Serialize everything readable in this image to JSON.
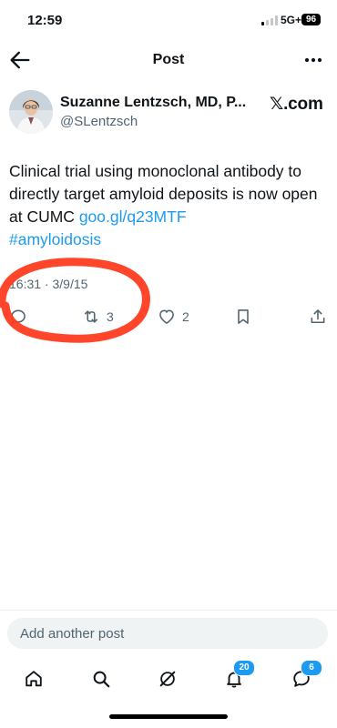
{
  "status_bar": {
    "time": "12:59",
    "network": "5G+",
    "battery": "96"
  },
  "header": {
    "title": "Post",
    "back_icon": "arrow-left-icon",
    "more_icon": "more-dots-icon"
  },
  "author": {
    "name": "Suzanne Lentzsch, MD, P...",
    "handle": "@SLentzsch",
    "source": "𝕏.com"
  },
  "post": {
    "text": "Clinical trial using monoclonal antibody to directly target amyloid deposits is now open at CUMC ",
    "link": "goo.gl/q23MTF",
    "hashtag": "#amyloidosis",
    "timestamp": "16:31 · 3/9/15"
  },
  "actions": {
    "reply_icon": "reply-icon",
    "retweet_icon": "retweet-icon",
    "retweet_count": "3",
    "like_icon": "heart-icon",
    "like_count": "2",
    "bookmark_icon": "bookmark-icon",
    "share_icon": "share-icon"
  },
  "reply": {
    "placeholder": "Add another post"
  },
  "tabs": [
    {
      "name": "home",
      "icon": "home-icon"
    },
    {
      "name": "search",
      "icon": "search-icon"
    },
    {
      "name": "grok",
      "icon": "grok-icon"
    },
    {
      "name": "notifications",
      "icon": "bell-icon",
      "badge": "20"
    },
    {
      "name": "messages",
      "icon": "messages-icon",
      "badge": "6"
    }
  ],
  "colors": {
    "accent": "#1d9bf0",
    "annotation": "#ff3b1f",
    "muted": "#536471"
  }
}
